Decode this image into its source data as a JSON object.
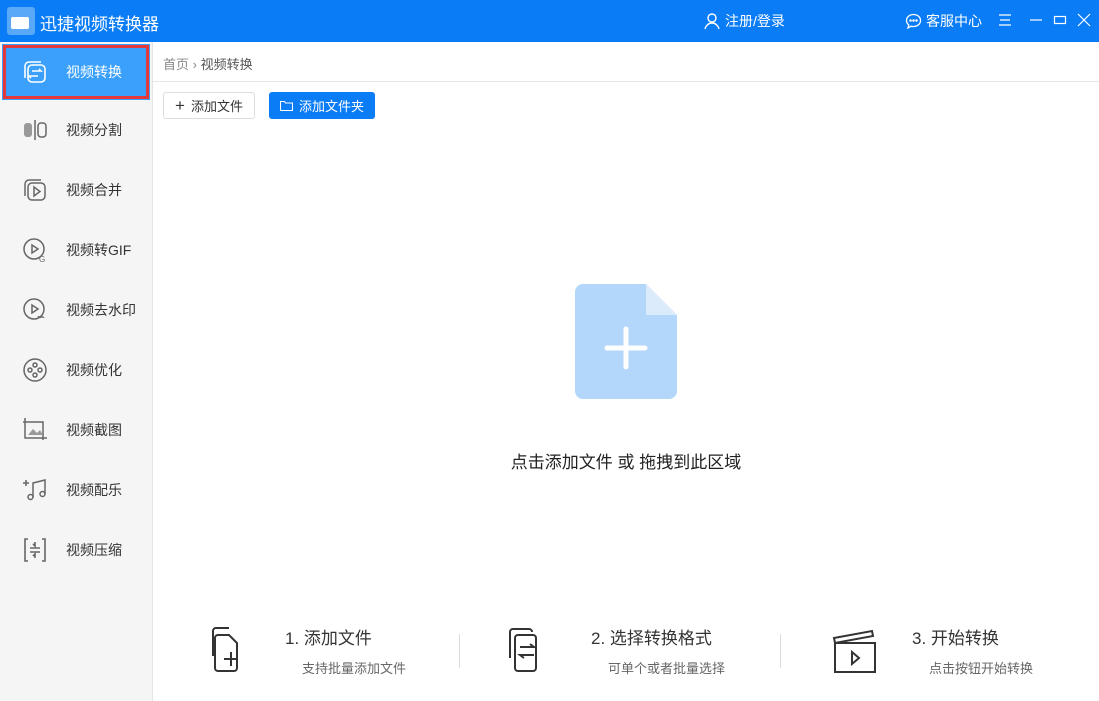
{
  "app": {
    "title": "迅捷视频转换器"
  },
  "titlebar": {
    "login": "注册/登录",
    "support": "客服中心"
  },
  "sidebar": {
    "items": [
      {
        "label": "视频转换",
        "icon": "convert-icon"
      },
      {
        "label": "视频分割",
        "icon": "split-icon"
      },
      {
        "label": "视频合并",
        "icon": "merge-icon"
      },
      {
        "label": "视频转GIF",
        "icon": "gif-icon"
      },
      {
        "label": "视频去水印",
        "icon": "watermark-icon"
      },
      {
        "label": "视频优化",
        "icon": "film-reel-icon"
      },
      {
        "label": "视频截图",
        "icon": "screenshot-icon"
      },
      {
        "label": "视频配乐",
        "icon": "music-icon"
      },
      {
        "label": "视频压缩",
        "icon": "compress-icon"
      }
    ]
  },
  "breadcrumb": {
    "home": "首页",
    "sep": "›",
    "current": "视频转换"
  },
  "toolbar": {
    "add_file": "添加文件",
    "add_folder": "添加文件夹"
  },
  "dropzone": {
    "text": "点击添加文件 或 拖拽到此区域"
  },
  "steps": [
    {
      "title": "1. 添加文件",
      "sub": "支持批量添加文件"
    },
    {
      "title": "2. 选择转换格式",
      "sub": "可单个或者批量选择"
    },
    {
      "title": "3. 开始转换",
      "sub": "点击按钮开始转换"
    }
  ]
}
